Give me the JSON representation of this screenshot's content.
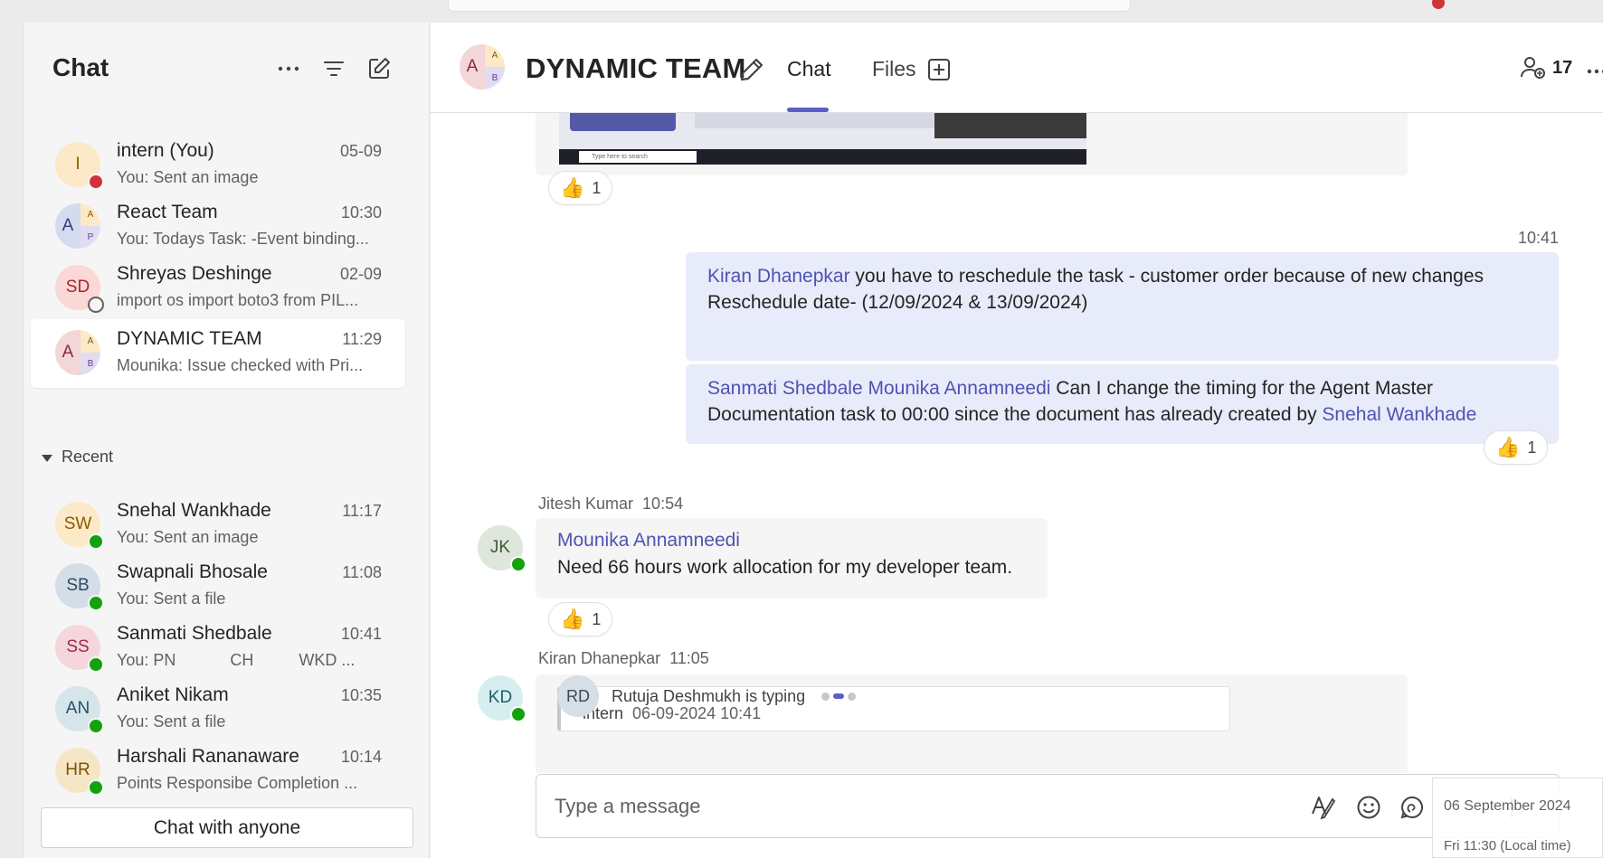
{
  "sidebar": {
    "title": "Chat",
    "chats": [
      {
        "initials": "I",
        "name": "intern (You)",
        "time": "05-09",
        "preview": "You: Sent an image",
        "status": "busy",
        "bg": "#fbe9c8",
        "fg": "#8a5a00"
      },
      {
        "initials": "A",
        "sub1": "A",
        "sub2": "P",
        "name": "React Team",
        "time": "10:30",
        "preview": "You: Todays Task: -Event binding...",
        "group": true
      },
      {
        "initials": "SD",
        "name": "Shreyas Deshinge",
        "time": "02-09",
        "preview": "import os import boto3 from PIL...",
        "status": "offline",
        "bg": "#fbd8d5",
        "fg": "#a4262c"
      },
      {
        "initials": "A",
        "sub1": "A",
        "sub2": "B",
        "name": "DYNAMIC TEAM",
        "time": "11:29",
        "preview": "Mounika: Issue checked with Pri...",
        "group": true,
        "active": true
      }
    ],
    "recent_label": "Recent",
    "recent": [
      {
        "initials": "SW",
        "name": "Snehal Wankhade",
        "time": "11:17",
        "preview": "You: Sent an image",
        "bg": "#fbe9c8",
        "fg": "#8a5a00"
      },
      {
        "initials": "SB",
        "name": "Swapnali Bhosale",
        "time": "11:08",
        "preview": "You: Sent a file",
        "bg": "#d3dee8",
        "fg": "#2f4a63"
      },
      {
        "initials": "SS",
        "name": "Sanmati Shedbale",
        "time": "10:41",
        "preview": "You: PN            CH          WKD ...",
        "bg": "#f6d6dd",
        "fg": "#9c2b47"
      },
      {
        "initials": "AN",
        "name": "Aniket Nikam",
        "time": "10:35",
        "preview": "You: Sent a file",
        "bg": "#d5e5ea",
        "fg": "#245266"
      },
      {
        "initials": "HR",
        "name": "Harshali Rananaware",
        "time": "10:14",
        "preview": "Points Responsibe Completion ...",
        "bg": "#f6e6c8",
        "fg": "#7a5200"
      }
    ],
    "chat_anyone": "Chat with anyone"
  },
  "header": {
    "avatar_initials": "A",
    "avatar_sub1": "A",
    "avatar_sub2": "B",
    "title": "DYNAMIC TEAM",
    "tabs": [
      "Chat",
      "Files"
    ],
    "participants": "17"
  },
  "messages": {
    "image_reaction_count": "1",
    "screenshot_search": "Type here to search",
    "my_time": "10:41",
    "m1": {
      "mention": "Kiran Dhanepkar",
      "text": " you have to reschedule the task - customer order  because of new changes",
      "line2": "Reschedule date- (12/09/2024 & 13/09/2024)"
    },
    "m2": {
      "mention1": "Sanmati Shedbale",
      "mention2": "Mounika Annamneedi",
      "text": " Can I change the timing for the Agent Master Documentation task  to 00:00 since the document has already created by ",
      "mention3": "Snehal Wankhade",
      "reaction_count": "1"
    },
    "m3": {
      "sender": "Jitesh Kumar",
      "time": "10:54",
      "initials": "JK",
      "mention": "Mounika Annamneedi",
      "text": "Need  66 hours work allocation for my developer team.",
      "reaction_count": "1"
    },
    "m4": {
      "sender": "Kiran Dhanepkar",
      "time": "11:05",
      "initials": "KD",
      "quote_author": "intern",
      "quote_date": "06-09-2024 10:41"
    }
  },
  "typing": {
    "initials": "RD",
    "text": "Rutuja Deshmukh is typing"
  },
  "composer": {
    "placeholder": "Type a message"
  },
  "date_tooltip": {
    "date": "06 September 2024",
    "local": "Fri 11:30 (Local time)"
  },
  "colors": {
    "accent": "#5b5fc7",
    "mention": "#4f52b2",
    "my_bubble": "#e8ebfa",
    "online": "#13a10e",
    "busy": "#d13438"
  }
}
